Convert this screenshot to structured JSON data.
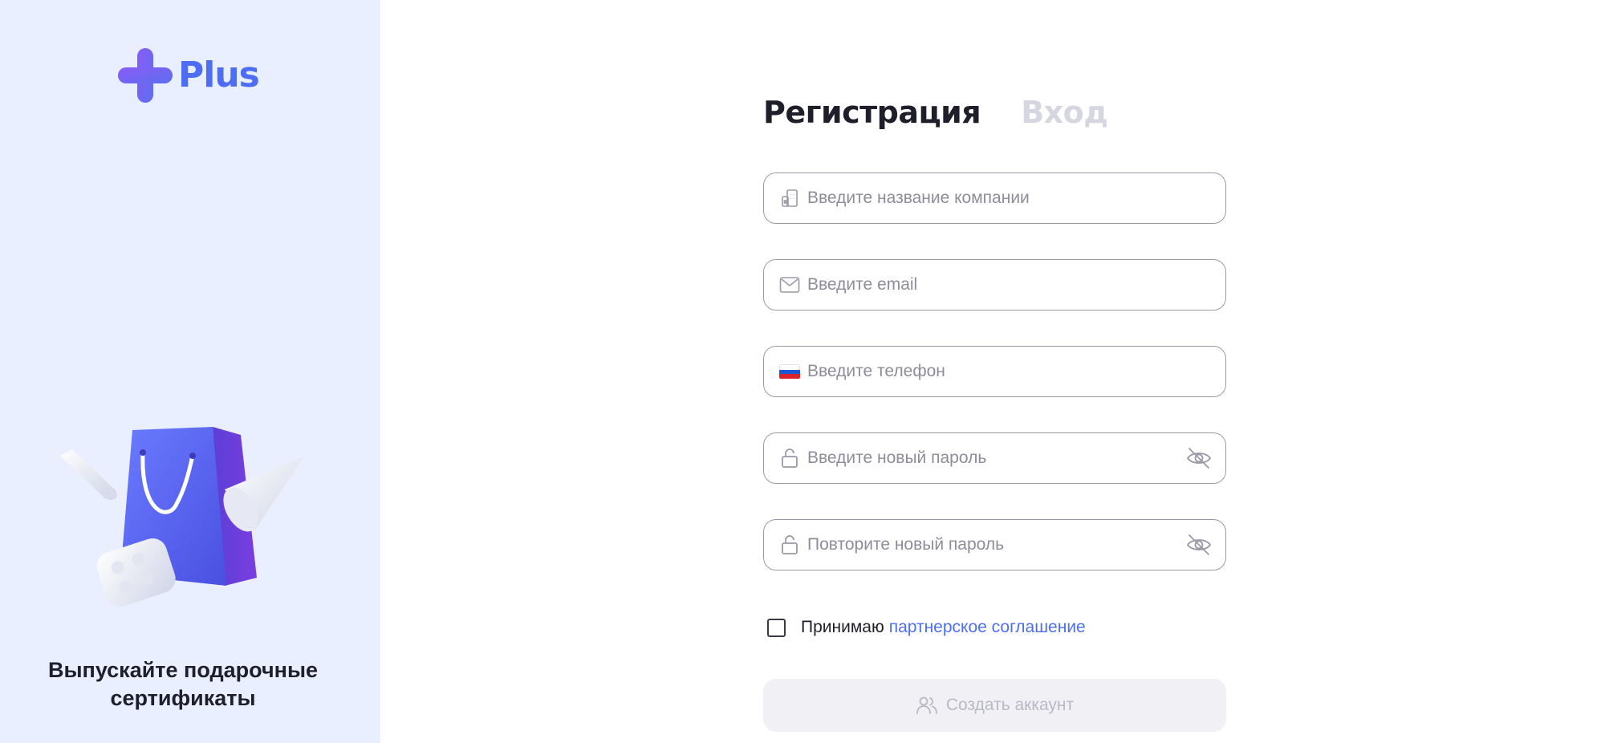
{
  "brand": {
    "logo_text": "Plus",
    "logo_icon": "plus-cross-icon",
    "accent_color": "#4d6ef2",
    "logo_gradient": [
      "#8a5cf6",
      "#5b6ef0"
    ]
  },
  "sidebar": {
    "background": "#e9efff",
    "illustration": "shopping-bag-gift-illustration",
    "promo_line1": "Выпускайте подарочные",
    "promo_line2": "сертификаты"
  },
  "tabs": [
    {
      "label": "Регистрация",
      "active": true
    },
    {
      "label": "Вход",
      "active": false
    }
  ],
  "form": {
    "company": {
      "placeholder": "Введите название компании",
      "icon": "building-icon",
      "value": ""
    },
    "email": {
      "placeholder": "Введите email",
      "icon": "envelope-icon",
      "value": ""
    },
    "phone": {
      "placeholder": "Введите телефон",
      "icon": "russia-flag-icon",
      "value": ""
    },
    "password": {
      "placeholder": "Введите новый пароль",
      "icon": "lock-icon",
      "toggle_icon": "eye-hidden-icon",
      "value": ""
    },
    "password_repeat": {
      "placeholder": "Повторите новый пароль",
      "icon": "lock-icon",
      "toggle_icon": "eye-hidden-icon",
      "value": ""
    }
  },
  "agreement": {
    "checked": false,
    "text": "Принимаю",
    "link_text": "партнерское соглашение"
  },
  "submit": {
    "label": "Создать аккаунт",
    "icon": "users-icon",
    "disabled": true
  }
}
